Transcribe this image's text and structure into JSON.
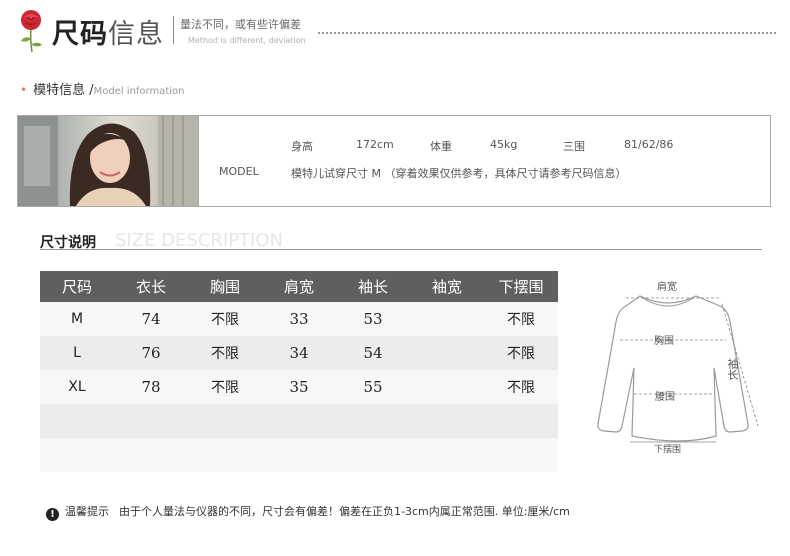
{
  "header": {
    "title_bold": "尺码",
    "title_light": "信息",
    "subtitle": "量法不同，或有些许偏差",
    "subtitle_en": "Method is different, deviation"
  },
  "model_info": {
    "label": "模特信息 /",
    "label_en": "Model information",
    "model_label": "MODEL",
    "height_label": "身高",
    "height_value": "172cm",
    "weight_label": "体重",
    "weight_value": "45kg",
    "measurements_label": "三围",
    "measurements_value": "81/62/86",
    "note": "模特儿试穿尺寸  M （穿着效果仅供参考，具体尺寸请参考尺码信息）"
  },
  "size_description": {
    "title": "尺寸说明",
    "title_en": "SIZE DESCRIPTION",
    "columns": [
      "尺码",
      "衣长",
      "胸围",
      "肩宽",
      "袖长",
      "袖宽",
      "下摆围"
    ],
    "rows": [
      [
        "M",
        "74",
        "不限",
        "33",
        "53",
        "",
        "不限"
      ],
      [
        "L",
        "76",
        "不限",
        "34",
        "54",
        "",
        "不限"
      ],
      [
        "XL",
        "78",
        "不限",
        "35",
        "55",
        "",
        "不限"
      ],
      [
        "",
        "",
        "",
        "",
        "",
        "",
        ""
      ],
      [
        "",
        "",
        "",
        "",
        "",
        "",
        ""
      ]
    ]
  },
  "diagram": {
    "shoulder": "肩宽",
    "chest": "胸围",
    "sleeve": "袖长",
    "waist": "腰围",
    "hem": "下摆围"
  },
  "footer": {
    "icon": "warning-icon",
    "label": "温馨提示",
    "text": "由于个人量法与仪器的不同，尺寸会有偏差！偏差在正负1-3cm内属正常范围. 单位:厘米/cm"
  }
}
